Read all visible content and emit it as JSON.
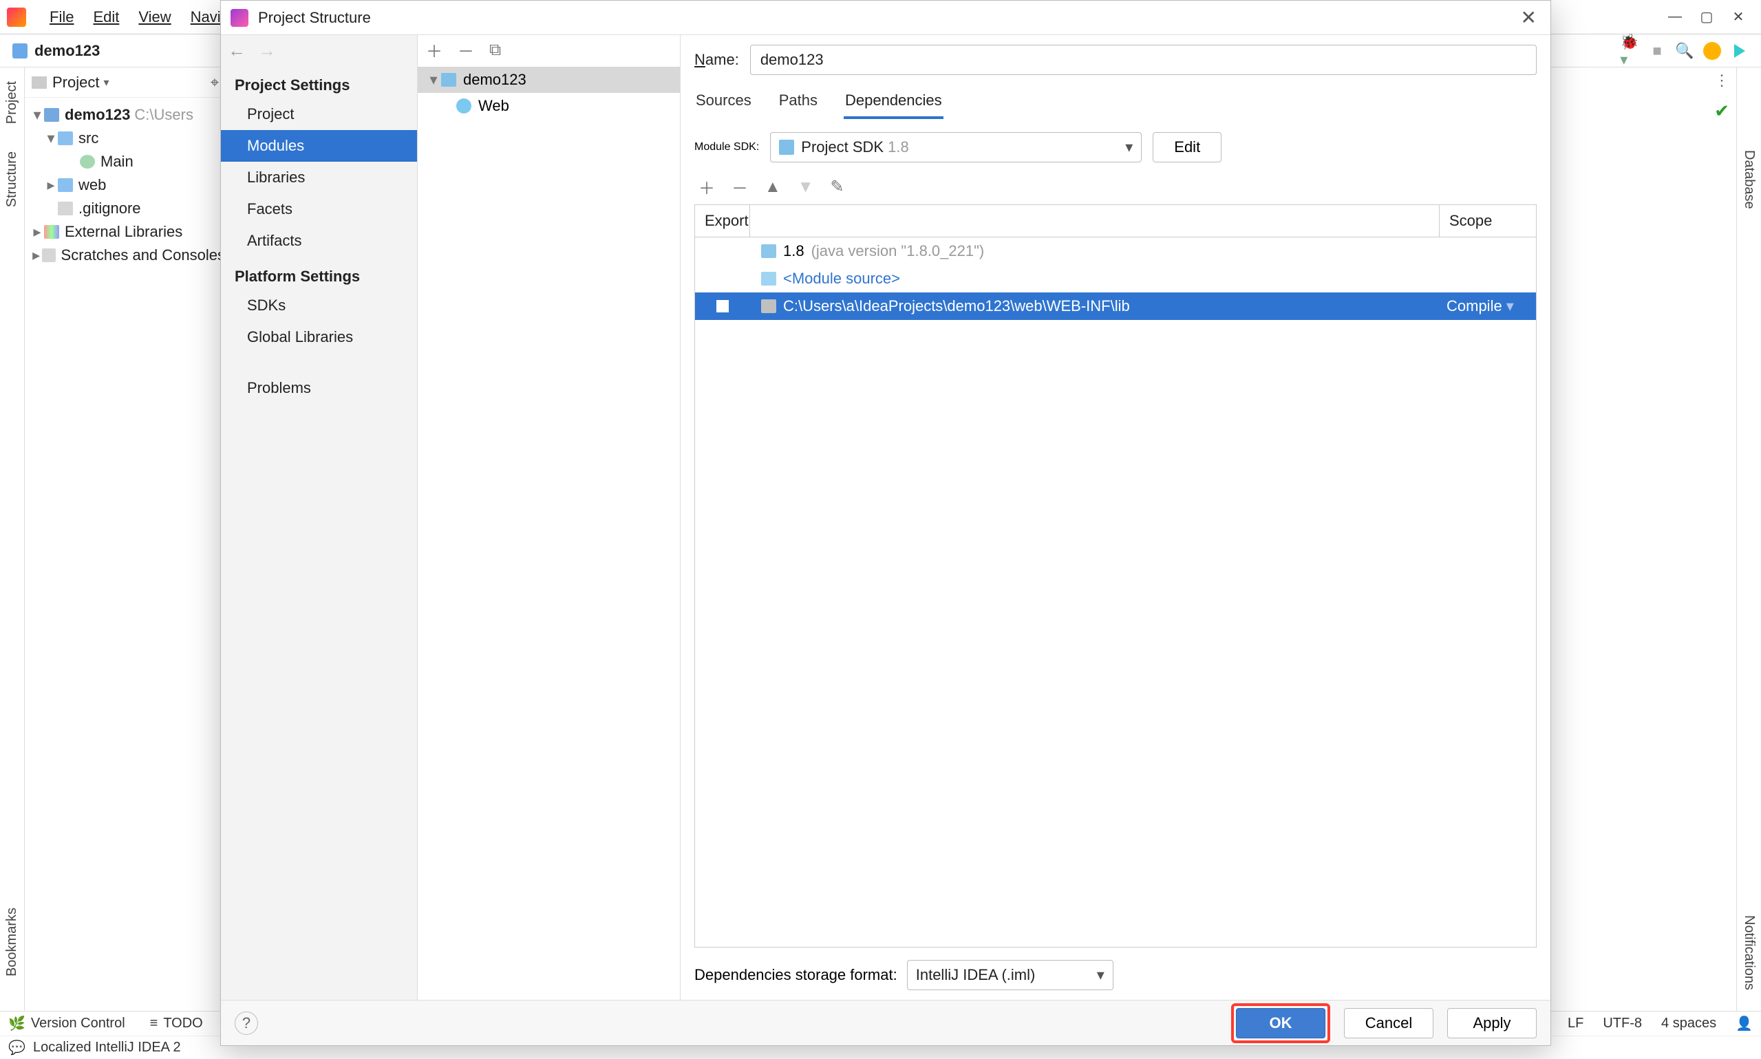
{
  "ide": {
    "menus": {
      "file": "File",
      "edit": "Edit",
      "view": "View",
      "nav": "Navigate"
    },
    "breadcrumb": {
      "project": "demo123"
    },
    "proj_panel": {
      "title": "Project",
      "root_name": "demo123",
      "root_path": "C:\\Users",
      "src": "src",
      "main": "Main",
      "web": "web",
      "gitignore": ".gitignore",
      "ext_libs": "External Libraries",
      "scratches": "Scratches and Consoles"
    },
    "left_gutter": {
      "project": "Project",
      "structure": "Structure",
      "bookmarks": "Bookmarks"
    },
    "right_gutter": {
      "database": "Database",
      "notifications": "Notifications"
    },
    "statusbar": {
      "version_control": "Version Control",
      "todo": "TODO",
      "lf": "LF",
      "encoding": "UTF-8",
      "indent": "4 spaces"
    },
    "msgbar": "Localized IntelliJ IDEA 2"
  },
  "dialog": {
    "title": "Project Structure",
    "nav": {
      "project_settings": "Project Settings",
      "project": "Project",
      "modules": "Modules",
      "libraries": "Libraries",
      "facets": "Facets",
      "artifacts": "Artifacts",
      "platform_settings": "Platform Settings",
      "sdks": "SDKs",
      "global_libraries": "Global Libraries",
      "problems": "Problems"
    },
    "modules_tree": {
      "root": "demo123",
      "web": "Web"
    },
    "main": {
      "name_label": "Name:",
      "name_value": "demo123",
      "tab_sources": "Sources",
      "tab_paths": "Paths",
      "tab_dependencies": "Dependencies",
      "sdk_label": "Module SDK:",
      "sdk_value": "Project SDK",
      "sdk_version": "1.8",
      "edit": "Edit",
      "table": {
        "col_export": "Export",
        "col_scope": "Scope",
        "row1_name": "1.8",
        "row1_detail": "(java version \"1.8.0_221\")",
        "row2_name": "<Module source>",
        "row3_name": "C:\\Users\\a\\IdeaProjects\\demo123\\web\\WEB-INF\\lib",
        "row3_scope": "Compile"
      },
      "storage_label": "Dependencies storage format:",
      "storage_value": "IntelliJ IDEA (.iml)"
    },
    "footer": {
      "ok": "OK",
      "cancel": "Cancel",
      "apply": "Apply"
    }
  }
}
